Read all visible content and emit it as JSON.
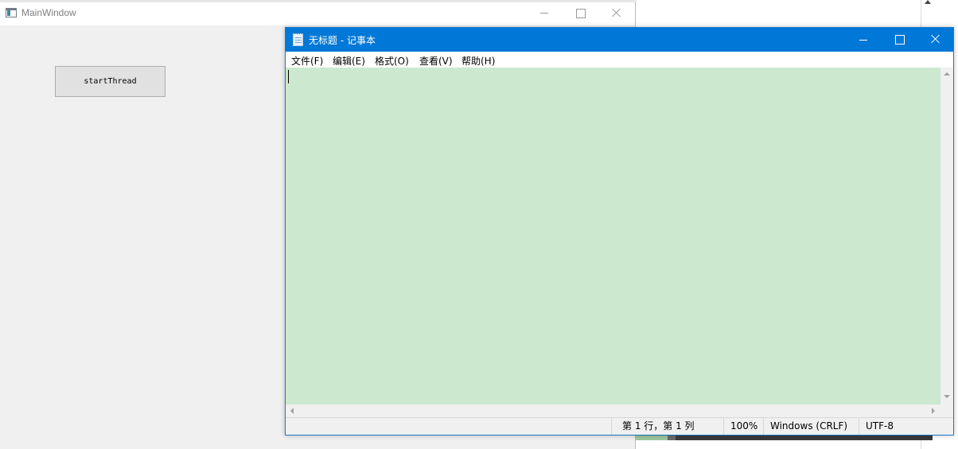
{
  "main_window": {
    "title": "MainWindow",
    "icon": "app-window-icon",
    "button_label": "startThread"
  },
  "notepad": {
    "title": "无标题 - 记事本",
    "icon": "notepad-icon",
    "menu": [
      "文件(F)",
      "编辑(E)",
      "格式(O)",
      "查看(V)",
      "帮助(H)"
    ],
    "content": "",
    "editor_bg": "#cce8cf",
    "titlebar_color": "#0078d7",
    "status": {
      "position": "第 1 行，第 1 列",
      "zoom": "100%",
      "line_ending": "Windows (CRLF)",
      "encoding": "UTF-8"
    }
  }
}
